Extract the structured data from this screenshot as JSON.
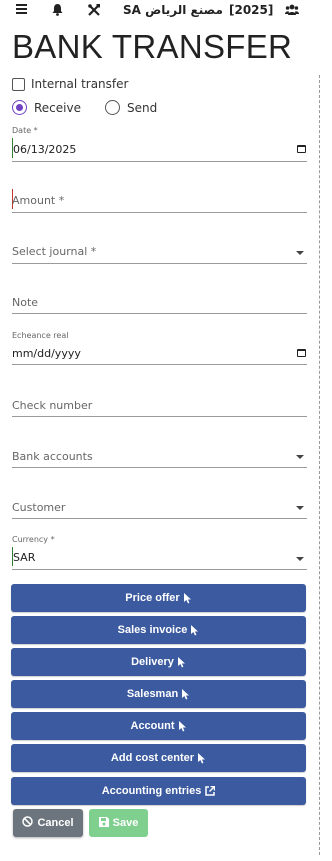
{
  "header": {
    "company": "SA مصنع الرياض",
    "year": "[2025]"
  },
  "page": {
    "title": "BANK TRANSFER"
  },
  "form": {
    "internal_transfer_label": "Internal transfer",
    "internal_transfer_checked": false,
    "radio_receive_label": "Receive",
    "radio_send_label": "Send",
    "selected_direction": "Receive",
    "date": {
      "label": "Date *",
      "value": "06/13/2025"
    },
    "amount": {
      "placeholder": "Amount *"
    },
    "journal": {
      "placeholder": "Select journal  *"
    },
    "note": {
      "placeholder": "Note"
    },
    "echeance": {
      "label": "Echeance real",
      "value": "mm/dd/yyyy"
    },
    "check_number": {
      "placeholder": "Check number"
    },
    "bank_accounts": {
      "placeholder": "Bank accounts"
    },
    "customer": {
      "placeholder": "Customer"
    },
    "currency": {
      "label": "Currency  *",
      "value": "SAR"
    }
  },
  "actions": [
    {
      "label": "Price offer",
      "icon": "pointer-icon"
    },
    {
      "label": "Sales invoice",
      "icon": "pointer-icon"
    },
    {
      "label": "Delivery",
      "icon": "pointer-icon"
    },
    {
      "label": "Salesman",
      "icon": "pointer-icon"
    },
    {
      "label": "Account",
      "icon": "pointer-icon"
    },
    {
      "label": "Add cost center",
      "icon": "pointer-icon"
    },
    {
      "label": "Accounting entries",
      "icon": "external-link-icon"
    }
  ],
  "footer": {
    "cancel_label": "Cancel",
    "save_label": "Save"
  },
  "colors": {
    "primary_button": "#3b5aa0",
    "cancel_button": "#6c757d",
    "save_button": "#7fcf8f",
    "radio_accent": "#6f42c1",
    "required_marker": "#c0392b",
    "focus_marker": "#2e7d32"
  }
}
